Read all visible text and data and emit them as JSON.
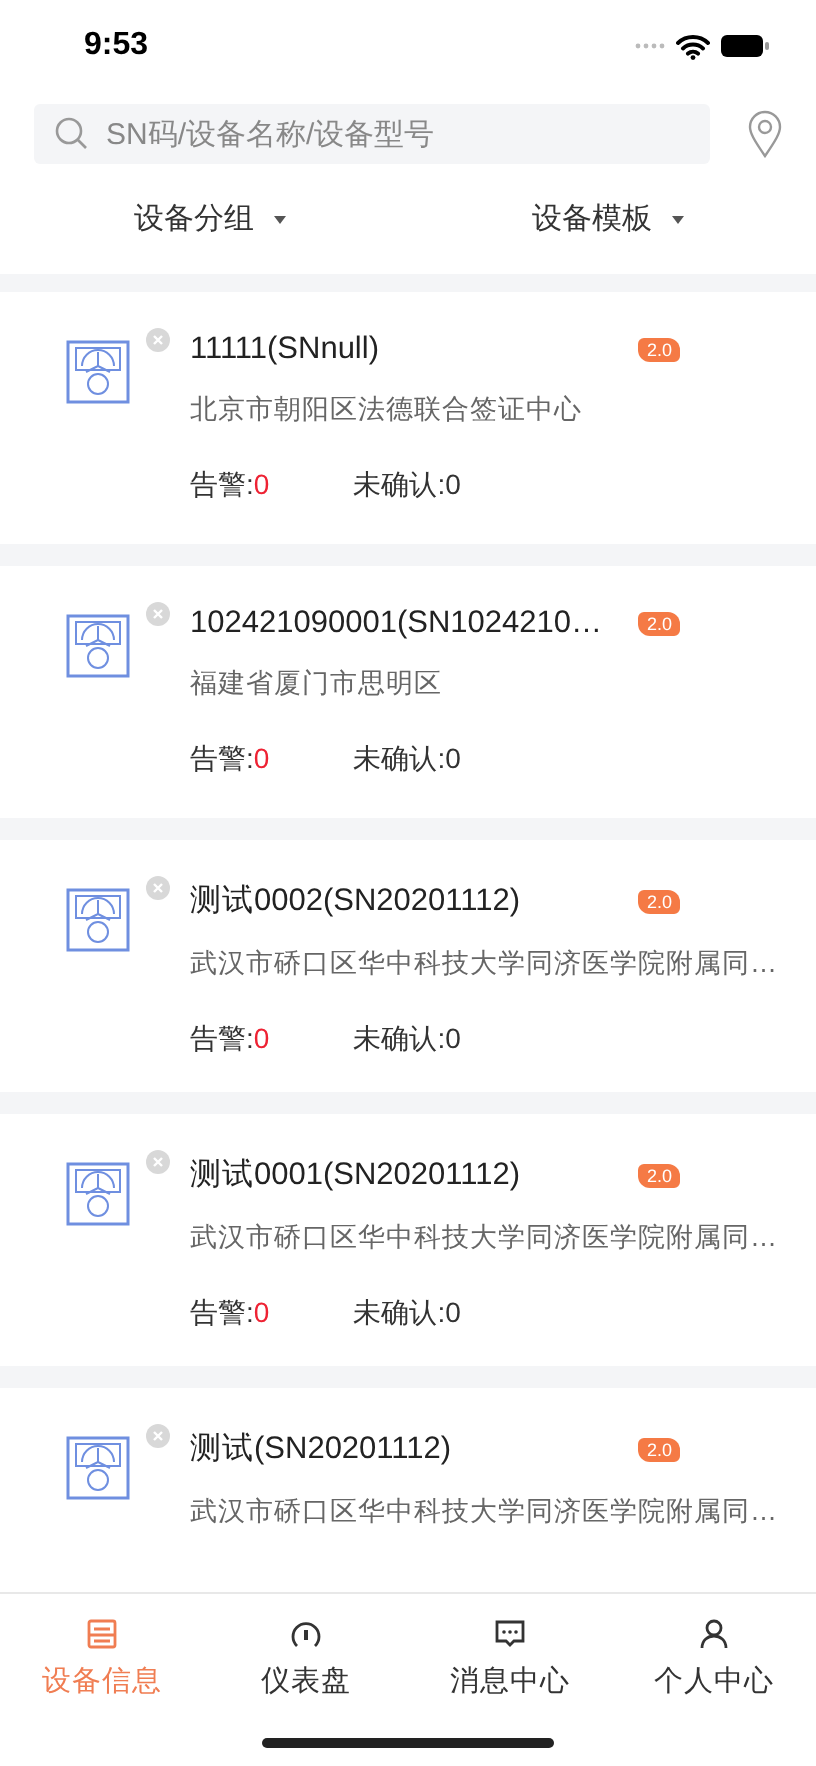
{
  "status_bar": {
    "time": "9:53"
  },
  "search": {
    "placeholder": "SN码/设备名称/设备型号"
  },
  "filters": [
    {
      "label": "设备分组"
    },
    {
      "label": "设备模板"
    }
  ],
  "devices": [
    {
      "title": "11111(SNnull)",
      "badge": "2.0",
      "address": "北京市朝阳区法德联合签证中心",
      "alarm_label": "告警:",
      "alarm": "0",
      "unconfirmed": "未确认:0"
    },
    {
      "title": "102421090001(SN1024210…",
      "badge": "2.0",
      "address": "福建省厦门市思明区",
      "alarm_label": "告警:",
      "alarm": "0",
      "unconfirmed": "未确认:0"
    },
    {
      "title": "测试0002(SN20201112)",
      "badge": "2.0",
      "address": "武汉市硚口区华中科技大学同济医学院附属同…",
      "alarm_label": "告警:",
      "alarm": "0",
      "unconfirmed": "未确认:0"
    },
    {
      "title": "测试0001(SN20201112)",
      "badge": "2.0",
      "address": "武汉市硚口区华中科技大学同济医学院附属同…",
      "alarm_label": "告警:",
      "alarm": "0",
      "unconfirmed": "未确认:0"
    },
    {
      "title": "测试(SN20201112)",
      "badge": "2.0",
      "address": "武汉市硚口区华中科技大学同济医学院附属同…"
    }
  ],
  "tabs": [
    {
      "kind": "device",
      "label": "设备信息",
      "selected": true
    },
    {
      "kind": "gauge",
      "label": "仪表盘",
      "selected": false
    },
    {
      "kind": "message",
      "label": "消息中心",
      "selected": false
    },
    {
      "kind": "person",
      "label": "个人中心",
      "selected": false
    }
  ]
}
